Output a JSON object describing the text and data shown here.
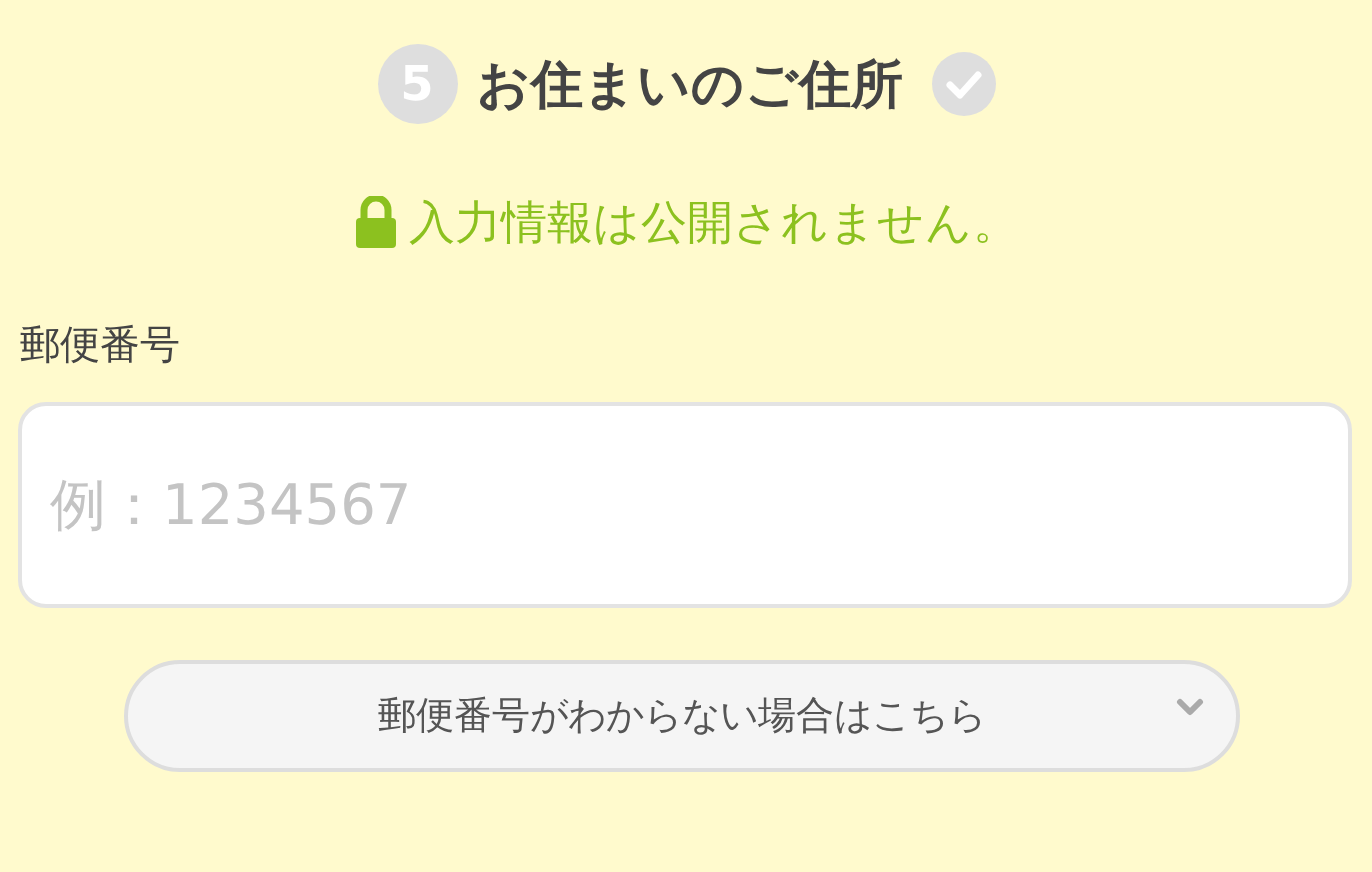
{
  "section": {
    "step": "5",
    "title": "お住まいのご住所",
    "completed": false
  },
  "privacy_note": "入力情報は公開されません。",
  "postal_code": {
    "label": "郵便番号",
    "placeholder": "例：1234567"
  },
  "help_toggle": {
    "label": "郵便番号がわからない場合はこちら",
    "expanded": false
  }
}
